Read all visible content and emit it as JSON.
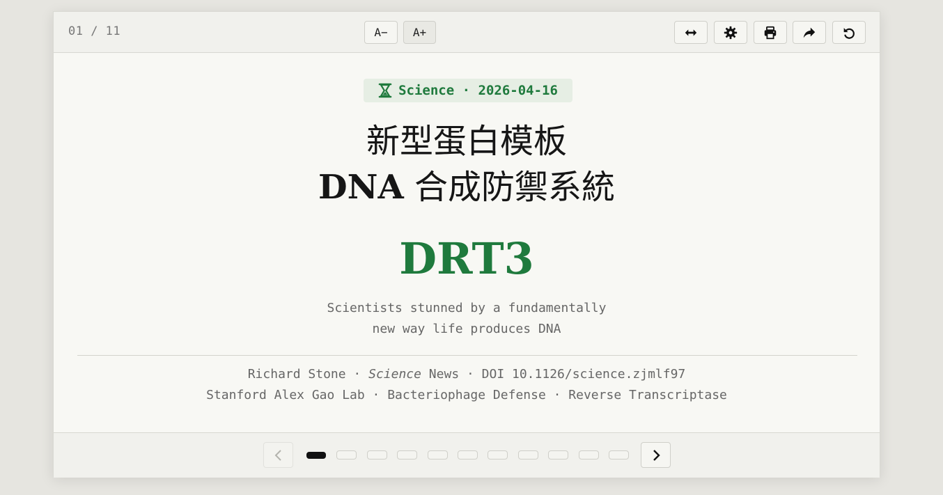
{
  "toolbar": {
    "counter": "01 / 11",
    "font_decrease_label": "A−",
    "font_increase_label": "A+",
    "icons": [
      "arrows-horizontal-icon",
      "gear-icon",
      "print-icon",
      "share-icon",
      "undo-icon"
    ]
  },
  "article": {
    "tag_icon": "hourglass-icon",
    "tag_text": "Science · 2026-04-16",
    "title_line1": "新型蛋白模板",
    "title_line2_latin": "DNA",
    "title_line2_cjk": " 合成防禦系統",
    "acronym": "DRT3",
    "subtitle_line1": "Scientists stunned by a fundamentally",
    "subtitle_line2": "new way life produces DNA",
    "meta_author": "Richard Stone · ",
    "meta_publication": "Science",
    "meta_rest": " News · DOI 10.1126/science.zjmlf97",
    "meta_line2": "Stanford Alex Gao Lab · Bacteriophage Defense · Reverse Transcriptase"
  },
  "pager": {
    "current": 1,
    "total": 11
  },
  "colors": {
    "accent": "#1f7a3d",
    "tag_bg": "#e6eee4",
    "page_bg": "#e6e5e0",
    "card_bg": "#f8f8f4"
  }
}
